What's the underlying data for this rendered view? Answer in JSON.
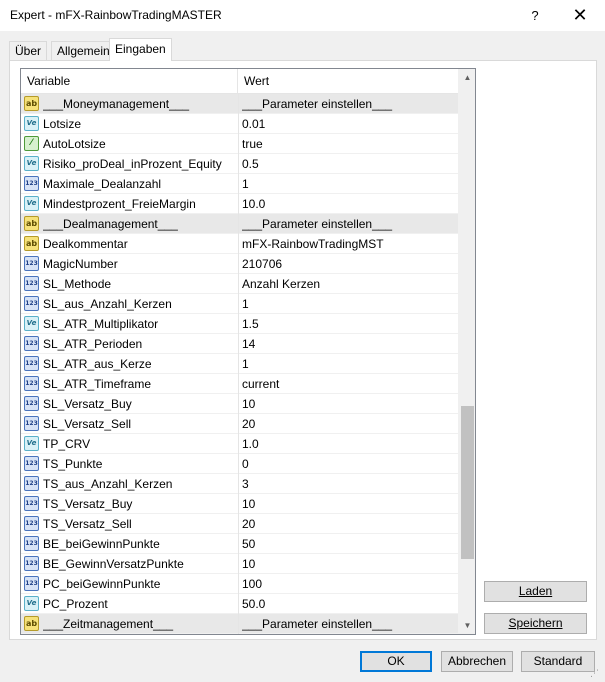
{
  "window": {
    "title": "Expert - mFX-RainbowTradingMASTER",
    "help_glyph": "?",
    "close_glyph": "✕"
  },
  "tabs": [
    {
      "label": "Über"
    },
    {
      "label": "Allgemein"
    },
    {
      "label": "Eingaben"
    }
  ],
  "grid": {
    "col_variable": "Variable",
    "col_value": "Wert",
    "rows": [
      {
        "icon": "ab",
        "name": "___Moneymanagement___",
        "value": "___Parameter einstellen___",
        "group": true
      },
      {
        "icon": "ve",
        "name": "Lotsize",
        "value": "0.01"
      },
      {
        "icon": "bool",
        "name": "AutoLotsize",
        "value": "true"
      },
      {
        "icon": "ve",
        "name": "Risiko_proDeal_inProzent_Equity",
        "value": "0.5"
      },
      {
        "icon": "123",
        "name": "Maximale_Dealanzahl",
        "value": "1"
      },
      {
        "icon": "ve",
        "name": "Mindestprozent_FreieMargin",
        "value": "10.0"
      },
      {
        "icon": "ab",
        "name": "___Dealmanagement___",
        "value": "___Parameter einstellen___",
        "group": true
      },
      {
        "icon": "ab",
        "name": "Dealkommentar",
        "value": "mFX-RainbowTradingMST"
      },
      {
        "icon": "123",
        "name": "MagicNumber",
        "value": "210706"
      },
      {
        "icon": "123",
        "name": "SL_Methode",
        "value": "Anzahl Kerzen"
      },
      {
        "icon": "123",
        "name": "SL_aus_Anzahl_Kerzen",
        "value": "1"
      },
      {
        "icon": "ve",
        "name": "SL_ATR_Multiplikator",
        "value": "1.5"
      },
      {
        "icon": "123",
        "name": "SL_ATR_Perioden",
        "value": "14"
      },
      {
        "icon": "123",
        "name": "SL_ATR_aus_Kerze",
        "value": "1"
      },
      {
        "icon": "123",
        "name": "SL_ATR_Timeframe",
        "value": "current"
      },
      {
        "icon": "123",
        "name": "SL_Versatz_Buy",
        "value": "10"
      },
      {
        "icon": "123",
        "name": "SL_Versatz_Sell",
        "value": "20"
      },
      {
        "icon": "ve",
        "name": "TP_CRV",
        "value": "1.0"
      },
      {
        "icon": "123",
        "name": "TS_Punkte",
        "value": "0"
      },
      {
        "icon": "123",
        "name": "TS_aus_Anzahl_Kerzen",
        "value": "3"
      },
      {
        "icon": "123",
        "name": "TS_Versatz_Buy",
        "value": "10"
      },
      {
        "icon": "123",
        "name": "TS_Versatz_Sell",
        "value": "20"
      },
      {
        "icon": "123",
        "name": "BE_beiGewinnPunkte",
        "value": "50"
      },
      {
        "icon": "123",
        "name": "BE_GewinnVersatzPunkte",
        "value": "10"
      },
      {
        "icon": "123",
        "name": "PC_beiGewinnPunkte",
        "value": "100"
      },
      {
        "icon": "ve",
        "name": "PC_Prozent",
        "value": "50.0"
      },
      {
        "icon": "ab",
        "name": "___Zeitmanagement___",
        "value": "___Parameter einstellen___",
        "group": true
      }
    ]
  },
  "icons": {
    "ab": "ab",
    "ve": "Ve",
    "123": "123",
    "bool": "⁄"
  },
  "buttons": {
    "laden": "Laden",
    "speichern": "Speichern",
    "ok": "OK",
    "abbrechen": "Abbrechen",
    "standard": "Standard"
  }
}
